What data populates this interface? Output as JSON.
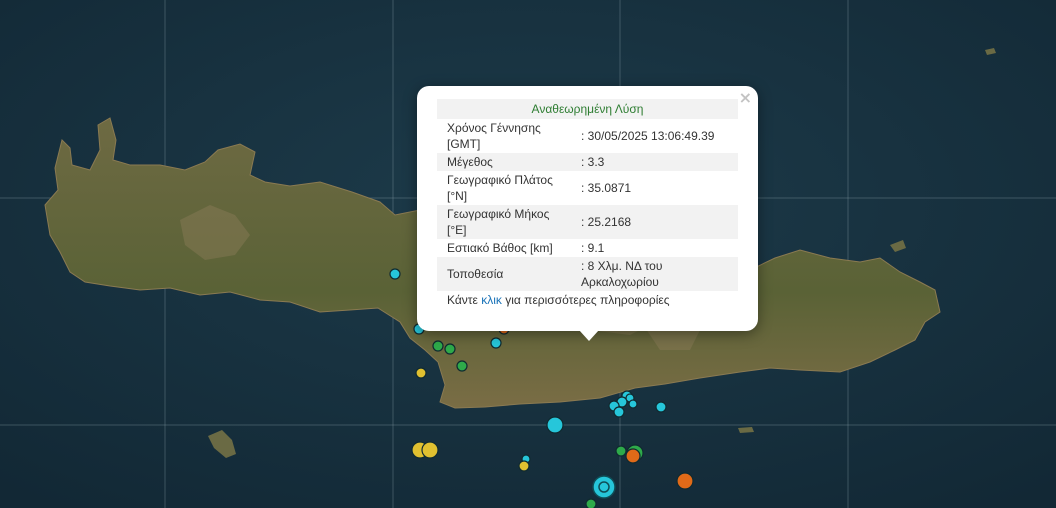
{
  "popup": {
    "title": "Αναθεωρημένη Λύση",
    "close_symbol": "×",
    "rows": [
      {
        "label": "Χρόνος Γέννησης [GMT]",
        "value": ": 30/05/2025 13:06:49.39"
      },
      {
        "label": "Μέγεθος",
        "value": ": 3.3"
      },
      {
        "label": "Γεωγραφικό Πλάτος [°N]",
        "value": ": 35.0871"
      },
      {
        "label": "Γεωγραφικό Μήκος [°E]",
        "value": ": 25.2168"
      },
      {
        "label": "Εστιακό Βάθος [km]",
        "value": ": 9.1"
      },
      {
        "label": "Τοποθεσία",
        "value": ": 8 Χλμ. ΝΔ του Αρκαλοχωρίου"
      }
    ],
    "more_prefix": "Κάντε ",
    "more_link": "κλικ",
    "more_suffix": " για περισσότερες πληροφορίες"
  },
  "map": {
    "basemap": "satellite",
    "colors": {
      "sea": "#17313e",
      "land": "#5e6a3c",
      "graticule": "#8aa0aa"
    },
    "marker_colors": {
      "cyan": "#26c6da",
      "green": "#2eaa4a",
      "yellow": "#e0c030",
      "orange": "#e06a18"
    }
  }
}
